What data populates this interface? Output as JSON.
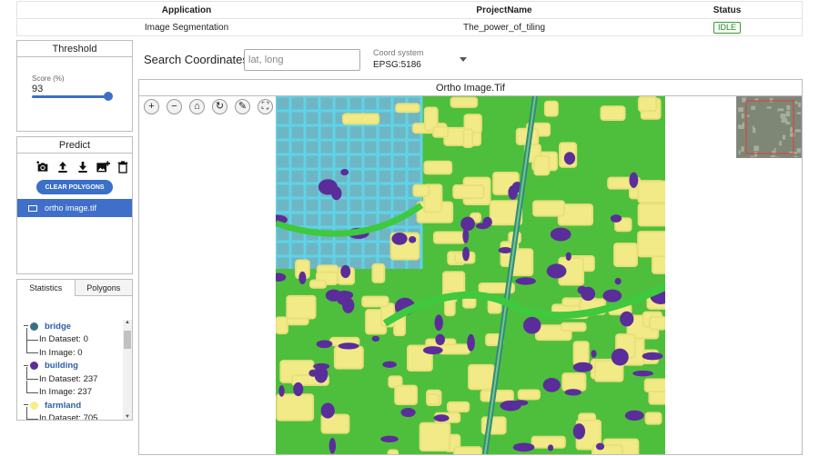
{
  "header": {
    "columns": [
      "Application",
      "ProjectName",
      "Status"
    ],
    "application": "Image Segmentation",
    "project_name": "The_power_of_tiling",
    "status": "IDLE"
  },
  "threshold": {
    "title": "Threshold",
    "score_label": "Score (%)",
    "score_value": "93",
    "score_fraction": 0.93
  },
  "predict": {
    "title": "Predict",
    "tools": [
      "camera-icon",
      "upload-icon",
      "download-icon",
      "add-image-icon",
      "trash-icon"
    ],
    "clear_label": "CLEAR POLYGONS",
    "file_name": "ortho image.tif"
  },
  "stats": {
    "tabs": [
      "Statistics",
      "Polygons"
    ],
    "classes": [
      {
        "name": "bridge",
        "color": "#3b7080",
        "in_dataset": "In Dataset: 0",
        "in_image": "In Image: 0"
      },
      {
        "name": "building",
        "color": "#5b2d9a",
        "in_dataset": "In Dataset: 237",
        "in_image": "In Image: 237"
      },
      {
        "name": "farmland",
        "color": "#f4ee8c",
        "in_dataset": "In Dataset: 705",
        "in_image": ""
      }
    ]
  },
  "search": {
    "label": "Search Coordinates:",
    "placeholder": "lat, long",
    "value": ""
  },
  "coord": {
    "label": "Coord system",
    "value": "EPSG:5186"
  },
  "map": {
    "title": "Ortho Image.Tif",
    "colors": {
      "road": "#4fc3d8",
      "forest": "#3fc93f",
      "farmland": "#f4ee8c",
      "building": "#5b2d9a"
    }
  }
}
